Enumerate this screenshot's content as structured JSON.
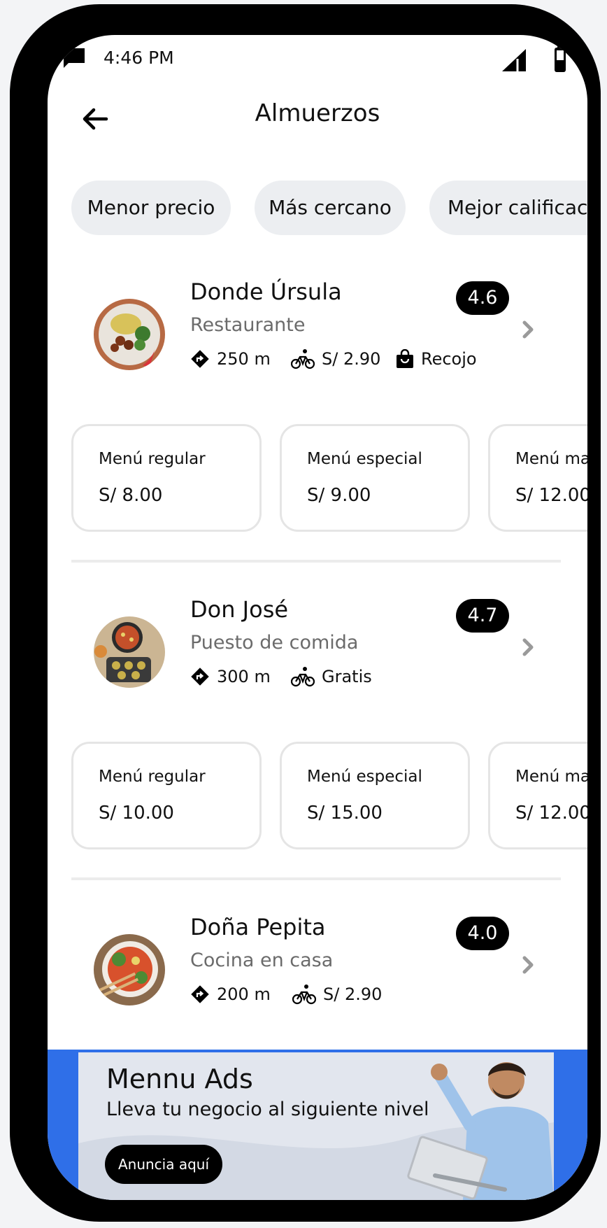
{
  "status_bar": {
    "time": "4:46 PM"
  },
  "header": {
    "title": "Almuerzos"
  },
  "filters": [
    "Menor precio",
    "Más cercano",
    "Mejor calificación"
  ],
  "restaurants": [
    {
      "name": "Donde Úrsula",
      "type": "Restaurante",
      "rating": "4.6",
      "distance": "250 m",
      "delivery": "S/ 2.90",
      "pickup": "Recojo",
      "menus": [
        {
          "name": "Menú regular",
          "price": "S/ 8.00"
        },
        {
          "name": "Menú especial",
          "price": "S/ 9.00"
        },
        {
          "name": "Menú marino",
          "price": "S/ 12.00"
        }
      ]
    },
    {
      "name": "Don José",
      "type": "Puesto de comida",
      "rating": "4.7",
      "distance": "300 m",
      "delivery": "Gratis",
      "menus": [
        {
          "name": "Menú regular",
          "price": "S/ 10.00"
        },
        {
          "name": "Menú especial",
          "price": "S/ 15.00"
        },
        {
          "name": "Menú marino",
          "price": "S/ 12.00"
        }
      ]
    },
    {
      "name": "Doña Pepita",
      "type": "Cocina en casa",
      "rating": "4.0",
      "distance": "200 m",
      "delivery": "S/ 2.90"
    }
  ],
  "ad": {
    "title": "Mennu Ads",
    "subtitle": "Lleva tu negocio al siguiente nivel",
    "button": "Anuncia aquí"
  },
  "colors": {
    "accent": "#2f6fe8",
    "chip_bg": "#eceef1",
    "rating_bg": "#000000"
  },
  "icons": [
    "message-icon",
    "signal-icon",
    "battery-icon",
    "back-arrow-icon",
    "chevron-right-icon",
    "directions-icon",
    "bicycle-icon",
    "shopping-bag-icon"
  ]
}
